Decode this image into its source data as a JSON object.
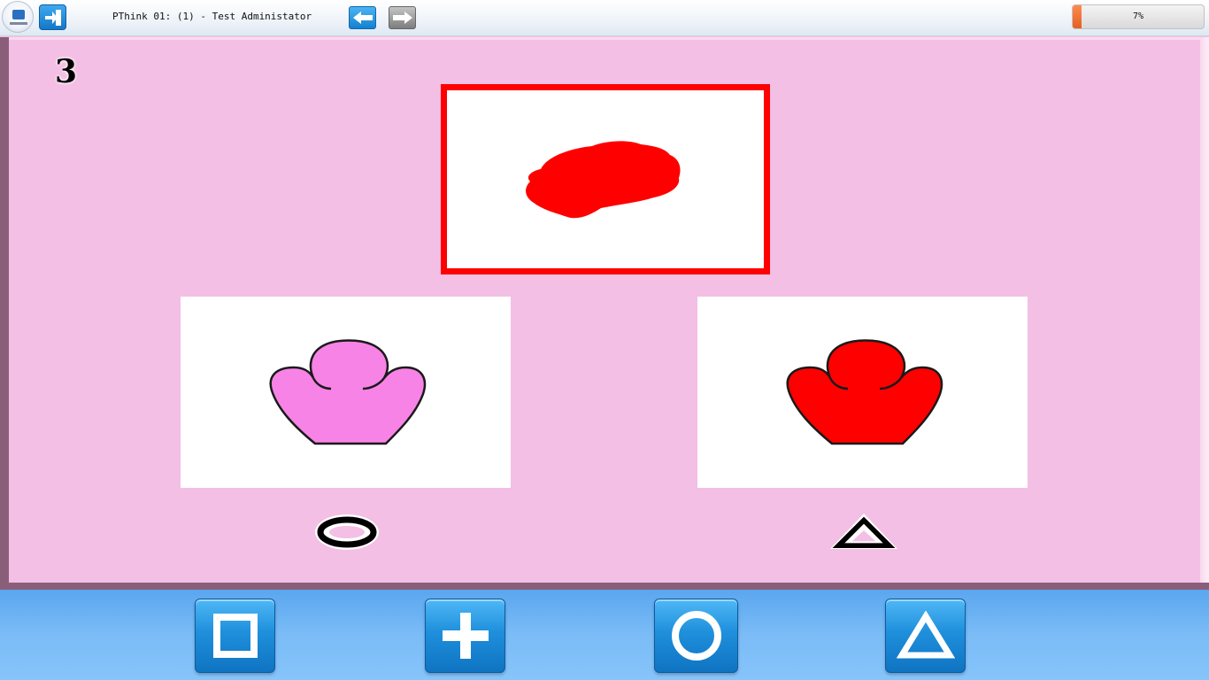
{
  "header": {
    "window_title": "PThink 01: (1) - Test Administator",
    "logo_icon": "app-logo-icon",
    "exit_icon": "exit-icon",
    "back_icon": "arrow-left-icon",
    "forward_icon": "arrow-right-icon",
    "progress": {
      "text": "7%",
      "fraction": 0.07
    }
  },
  "item": {
    "number": "3",
    "target": {
      "shape": "red-scribble",
      "color": "#ff0000"
    },
    "choices": [
      {
        "shape": "bloom",
        "color": "#f783e6",
        "symbol": "circle-icon"
      },
      {
        "shape": "bloom",
        "color": "#ff0000",
        "symbol": "triangle-icon"
      }
    ]
  },
  "answer_buttons": [
    {
      "icon": "square-icon"
    },
    {
      "icon": "plus-icon"
    },
    {
      "icon": "circle-icon"
    },
    {
      "icon": "triangle-icon"
    }
  ],
  "colors": {
    "board": "#f3bfe4",
    "board_edge": "#8a5e79",
    "target_border": "#ff0000",
    "button_blue": "#1f8fdc",
    "progress_orange": "#e4601f"
  }
}
